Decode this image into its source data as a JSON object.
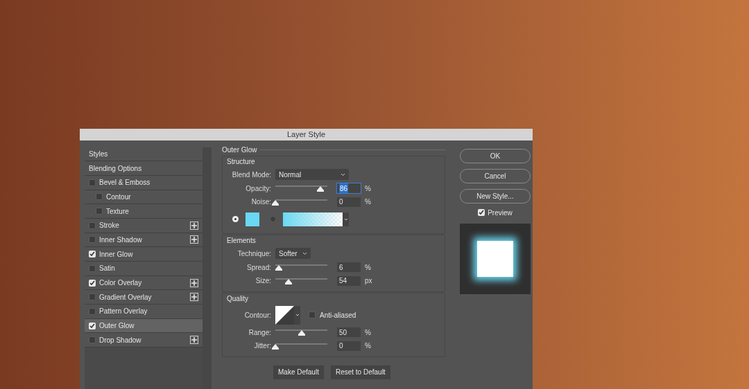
{
  "window": {
    "title": "Layer Style"
  },
  "styles": [
    {
      "label": "Styles",
      "kind": "header",
      "selected": false
    },
    {
      "label": "Blending Options",
      "kind": "header",
      "selected": false
    },
    {
      "label": "Bevel & Emboss",
      "kind": "effect",
      "checked": false,
      "selected": false,
      "add_button": false,
      "children": [
        {
          "label": "Contour",
          "kind": "effect",
          "checked": false,
          "selected": false,
          "add_button": false
        },
        {
          "label": "Texture",
          "kind": "effect",
          "checked": false,
          "selected": false,
          "add_button": false
        }
      ]
    },
    {
      "label": "Stroke",
      "kind": "effect",
      "checked": false,
      "selected": false,
      "add_button": true
    },
    {
      "label": "Inner Shadow",
      "kind": "effect",
      "checked": false,
      "selected": false,
      "add_button": true
    },
    {
      "label": "Inner Glow",
      "kind": "effect",
      "checked": true,
      "selected": false,
      "add_button": false
    },
    {
      "label": "Satin",
      "kind": "effect",
      "checked": false,
      "selected": false,
      "add_button": false
    },
    {
      "label": "Color Overlay",
      "kind": "effect",
      "checked": true,
      "selected": false,
      "add_button": true
    },
    {
      "label": "Gradient Overlay",
      "kind": "effect",
      "checked": false,
      "selected": false,
      "add_button": true
    },
    {
      "label": "Pattern Overlay",
      "kind": "effect",
      "checked": false,
      "selected": false,
      "add_button": false
    },
    {
      "label": "Outer Glow",
      "kind": "effect",
      "checked": true,
      "selected": true,
      "add_button": false
    },
    {
      "label": "Drop Shadow",
      "kind": "effect",
      "checked": false,
      "selected": false,
      "add_button": true
    }
  ],
  "panel": {
    "title": "Outer Glow",
    "sections": [
      {
        "title": "Structure",
        "rows": [
          {
            "kind": "dropdown",
            "label": "Blend Mode:",
            "value": "Normal"
          },
          {
            "kind": "slider",
            "label": "Opacity:",
            "level": 0.86,
            "value": "86",
            "unit": "%",
            "focused": true
          },
          {
            "kind": "slider",
            "label": "Noise:",
            "level": 0,
            "value": "0",
            "unit": "%",
            "focused": false
          },
          {
            "kind": "fill",
            "solid_selected": true,
            "gradient_selected": false,
            "color": "#6ad8f2"
          }
        ]
      },
      {
        "title": "Elements",
        "rows": [
          {
            "kind": "dropdown",
            "label": "Technique:",
            "value": "Softer"
          },
          {
            "kind": "slider",
            "label": "Spread:",
            "level": 0.06,
            "value": "6",
            "unit": "%",
            "focused": false
          },
          {
            "kind": "slider",
            "label": "Size:",
            "level": 0.25,
            "value": "54",
            "unit": "px",
            "focused": false
          }
        ]
      },
      {
        "title": "Quality",
        "rows": [
          {
            "kind": "contour",
            "label": "Contour:",
            "checkbox_label": "Anti-aliased",
            "checked": false
          },
          {
            "kind": "slider",
            "label": "Range:",
            "level": 0.5,
            "value": "50",
            "unit": "%",
            "focused": false
          },
          {
            "kind": "slider",
            "label": "Jitter:",
            "level": 0,
            "value": "0",
            "unit": "%",
            "focused": false
          }
        ]
      }
    ],
    "buttons": [
      "Make Default",
      "Reset to Default"
    ]
  },
  "actions": [
    "OK",
    "Cancel",
    "New Style..."
  ],
  "preview": {
    "label": "Preview",
    "checked": true
  }
}
